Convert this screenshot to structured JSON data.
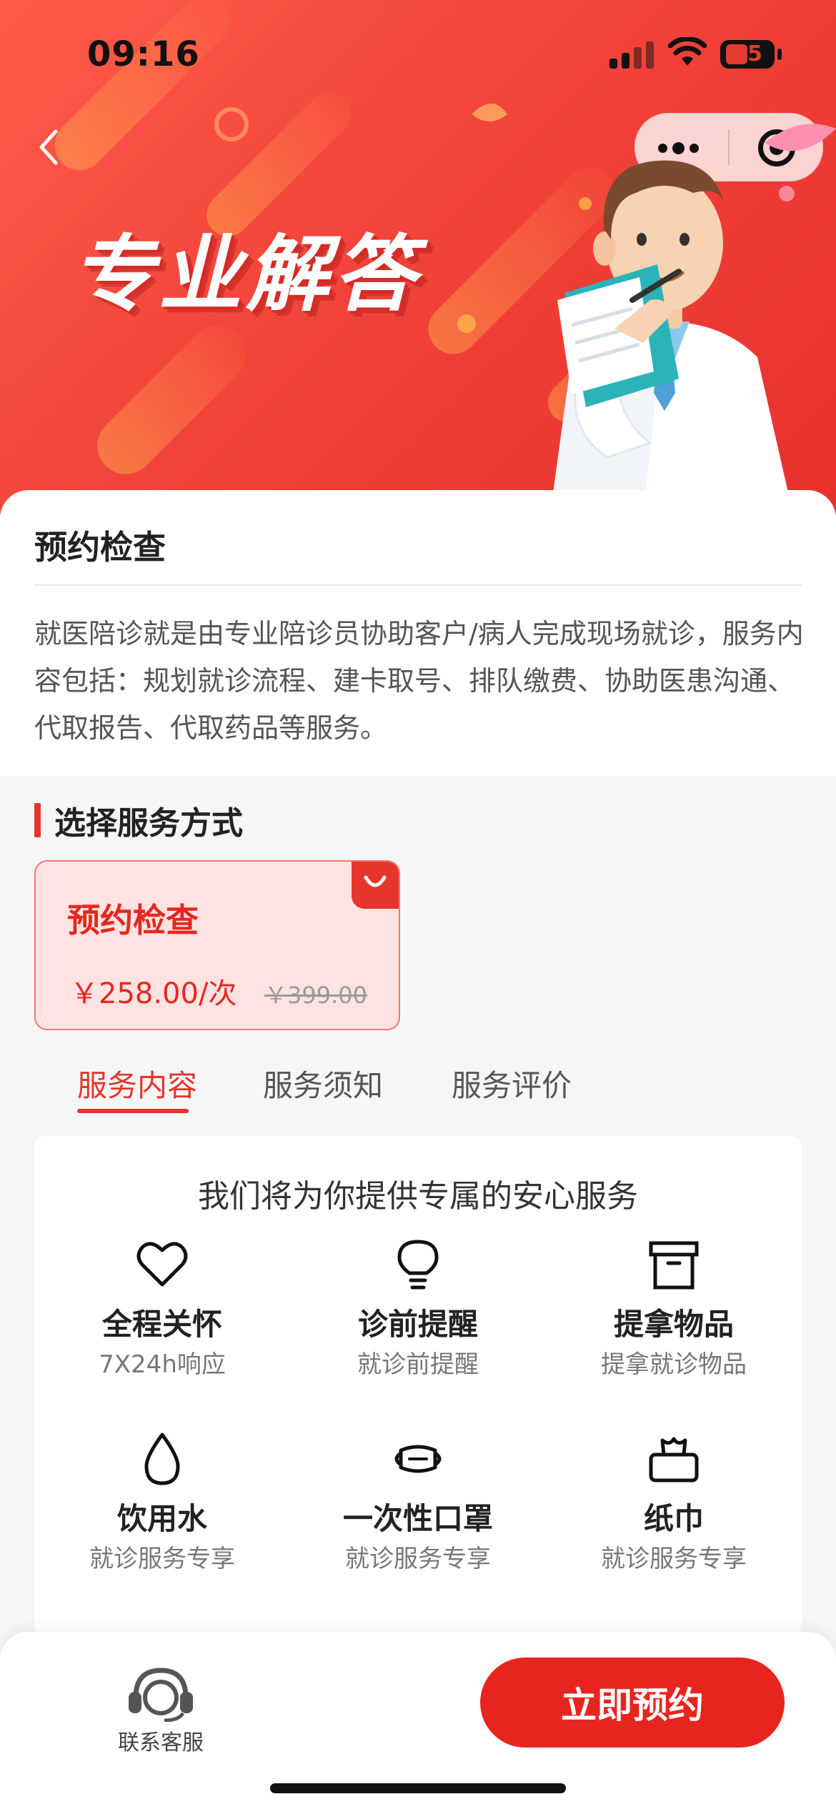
{
  "status_bar": {
    "time": "09:16",
    "battery": "35"
  },
  "banner": {
    "title": "专业解答"
  },
  "intro": {
    "title": "预约检查",
    "description": "就医陪诊就是由专业陪诊员协助客户/病人完成现场就诊，服务内容包括：规划就诊流程、建卡取号、排队缴费、协助医患沟通、代取报告、代取药品等服务。"
  },
  "service_select": {
    "title": "选择服务方式",
    "options": [
      {
        "name": "预约检查",
        "price": "￥258.00/次",
        "original_price": "￥399.00",
        "selected": true
      }
    ]
  },
  "tabs": [
    {
      "label": "服务内容",
      "active": true
    },
    {
      "label": "服务须知",
      "active": false
    },
    {
      "label": "服务评价",
      "active": false
    }
  ],
  "services": {
    "heading": "我们将为你提供专属的安心服务",
    "items": [
      {
        "icon": "heart-icon",
        "title": "全程关怀",
        "subtitle": "7X24h响应"
      },
      {
        "icon": "lightbulb-icon",
        "title": "诊前提醒",
        "subtitle": "就诊前提醒"
      },
      {
        "icon": "box-icon",
        "title": "提拿物品",
        "subtitle": "提拿就诊物品"
      },
      {
        "icon": "water-drop-icon",
        "title": "饮用水",
        "subtitle": "就诊服务专享"
      },
      {
        "icon": "mask-icon",
        "title": "一次性口罩",
        "subtitle": "就诊服务专享"
      },
      {
        "icon": "tissue-icon",
        "title": "纸巾",
        "subtitle": "就诊服务专享"
      }
    ]
  },
  "bottom_bar": {
    "customer_service": "联系客服",
    "book_button": "立即预约"
  },
  "colors": {
    "accent": "#e7342d",
    "selected_bg": "#ffe2e2",
    "banner": "#f2443a"
  }
}
